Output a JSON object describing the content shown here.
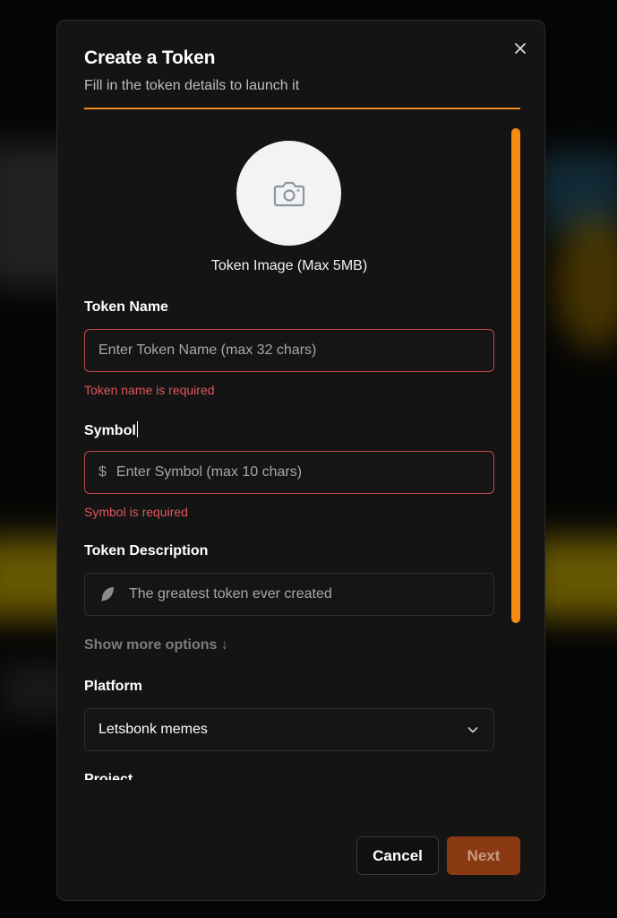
{
  "modal": {
    "title": "Create a Token",
    "subtitle": "Fill in the token details to launch it",
    "close_icon": "close-icon",
    "accent_color": "#f08a1a"
  },
  "image_upload": {
    "icon": "camera-icon",
    "label": "Token Image (Max 5MB)"
  },
  "token_name": {
    "label": "Token Name",
    "placeholder": "Enter Token Name (max 32 chars)",
    "error": "Token name is required"
  },
  "symbol": {
    "label": "Symbol",
    "prefix": "$",
    "placeholder": "Enter Symbol (max 10 chars)",
    "error": "Symbol is required"
  },
  "description": {
    "label": "Token Description",
    "icon": "feather-icon",
    "placeholder": "The greatest token ever created"
  },
  "show_more": "Show more options ↓",
  "platform": {
    "label": "Platform",
    "value": "Letsbonk memes",
    "icon": "chevron-down-icon"
  },
  "next_section_label": "Project",
  "footer": {
    "cancel_label": "Cancel",
    "next_label": "Next"
  },
  "colors": {
    "error": "#e0575b",
    "next_button": "#8a3a12"
  }
}
